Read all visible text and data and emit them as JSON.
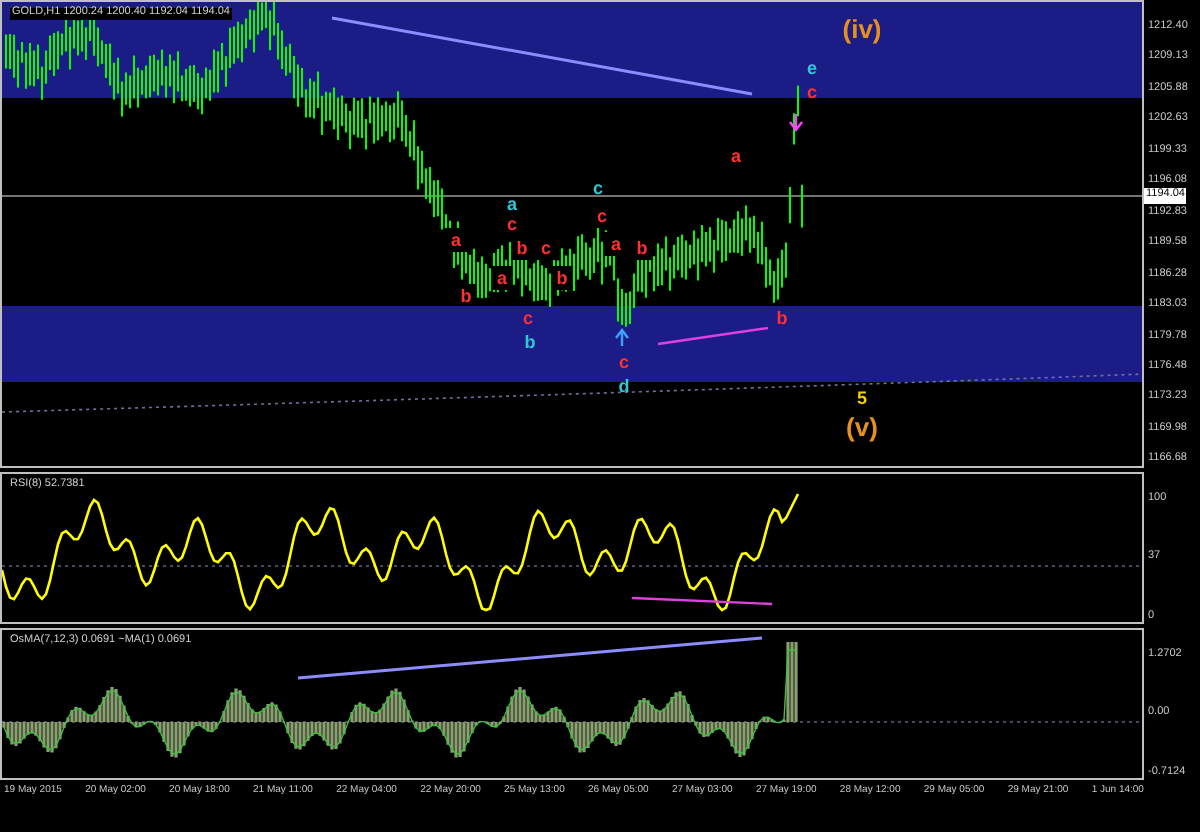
{
  "main_pane": {
    "header": "GOLD,H1  1200.24 1200.40 1192.04 1194.04",
    "price_axis": [
      "1212.40",
      "1209.13",
      "1205.88",
      "1202.63",
      "1199.33",
      "1196.08",
      "1192.83",
      "1189.58",
      "1186.28",
      "1183.03",
      "1179.78",
      "1176.48",
      "1173.23",
      "1169.98",
      "1166.68"
    ],
    "current_price": "1194.04",
    "wave_labels": [
      {
        "text": "(iv)",
        "color": "#e8901e"
      },
      {
        "text": "e",
        "color": "#2ec8d8"
      },
      {
        "text": "c",
        "color": "#ff3030"
      },
      {
        "text": "a",
        "color": "#ff3030"
      },
      {
        "text": "a",
        "color": "#2ec8d8"
      },
      {
        "text": "c",
        "color": "#ff3030"
      },
      {
        "text": "c",
        "color": "#2ec8d8"
      },
      {
        "text": "c",
        "color": "#ff3030"
      },
      {
        "text": "a",
        "color": "#ff3030"
      },
      {
        "text": "b",
        "color": "#ff3030"
      },
      {
        "text": "c",
        "color": "#ff3030"
      },
      {
        "text": "b",
        "color": "#ff3030"
      },
      {
        "text": "a",
        "color": "#ff3030"
      },
      {
        "text": "b",
        "color": "#ff3030"
      },
      {
        "text": "a",
        "color": "#ff3030"
      },
      {
        "text": "b",
        "color": "#ff3030"
      },
      {
        "text": "c",
        "color": "#ff3030"
      },
      {
        "text": "b",
        "color": "#ff3030"
      },
      {
        "text": "b",
        "color": "#2ec8d8"
      },
      {
        "text": "c",
        "color": "#ff3030"
      },
      {
        "text": "d",
        "color": "#2ec8d8"
      },
      {
        "text": "5",
        "color": "#f0d000"
      },
      {
        "text": "(v)",
        "color": "#e8901e"
      }
    ]
  },
  "rsi_pane": {
    "header": "RSI(8) 52.7381",
    "axis": [
      "100",
      "37",
      "0"
    ]
  },
  "osma_pane": {
    "header": "OsMA(7,12,3) 0.0691  ~MA(1) 0.0691",
    "axis": [
      "1.2702",
      "0.00",
      "-0.7124"
    ]
  },
  "time_axis": [
    "19 May 2015",
    "20 May 02:00",
    "20 May 18:00",
    "21 May 11:00",
    "22 May 04:00",
    "22 May 20:00",
    "25 May 13:00",
    "26 May 05:00",
    "27 May 03:00",
    "27 May 19:00",
    "28 May 12:00",
    "29 May 05:00",
    "29 May 21:00",
    "1 Jun 14:00"
  ]
}
